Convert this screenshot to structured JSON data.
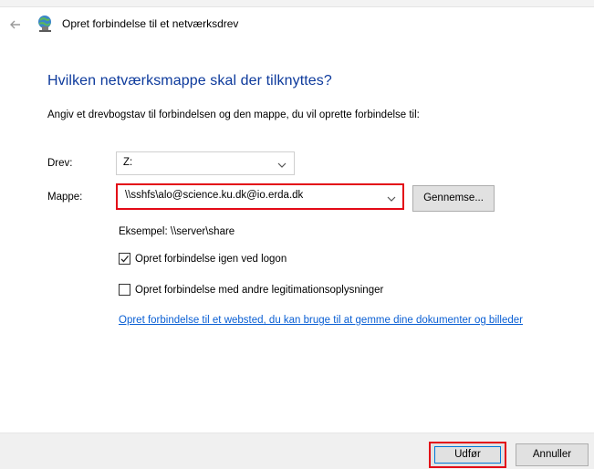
{
  "window": {
    "title": "Opret forbindelse til et netværksdrev"
  },
  "nav": {
    "back_icon": "back-arrow-icon",
    "title_icon": "network-drive-icon"
  },
  "main": {
    "heading": "Hvilken netværksmappe skal der tilknyttes?",
    "instruction": "Angiv et drevbogstav til forbindelsen og den mappe, du vil oprette forbindelse til:",
    "drive": {
      "label": "Drev:",
      "value": "Z:"
    },
    "folder": {
      "label": "Mappe:",
      "value": "\\\\sshfs\\alo@science.ku.dk@io.erda.dk",
      "browse_label": "Gennemse..."
    },
    "example": "Eksempel: \\\\server\\share",
    "reconnect": {
      "label": "Opret forbindelse igen ved logon",
      "checked": true
    },
    "other_credentials": {
      "label": "Opret forbindelse med andre legitimationsoplysninger",
      "checked": false
    },
    "link": "Opret forbindelse til et websted, du kan bruge til at gemme dine dokumenter og billeder"
  },
  "footer": {
    "finish_label": "Udfør",
    "cancel_label": "Annuller"
  },
  "colors": {
    "heading": "#0d3a9c",
    "link": "#0a5fd4",
    "highlight": "#e30a17"
  }
}
